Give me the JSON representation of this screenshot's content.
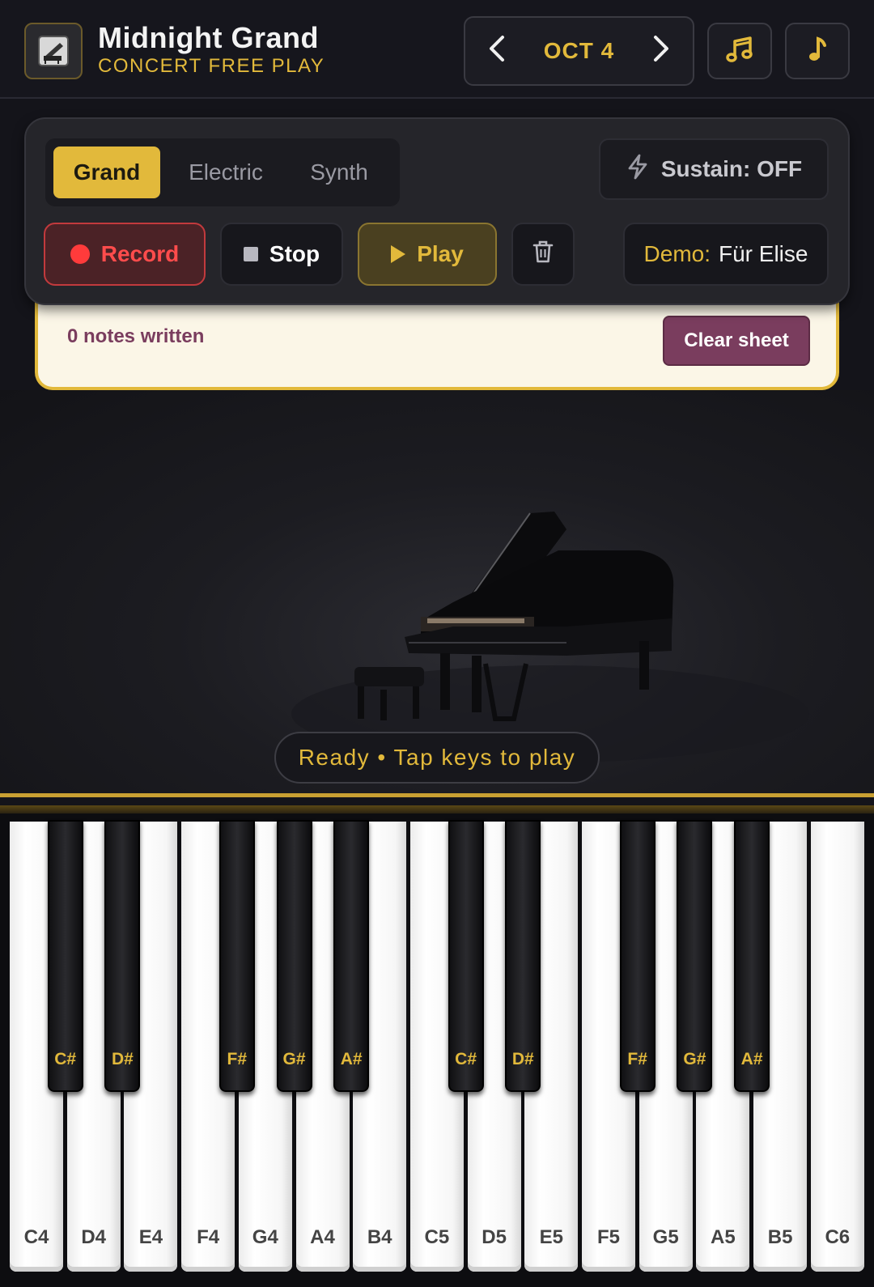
{
  "app": {
    "title": "Midnight Grand",
    "subtitle": "CONCERT FREE PLAY"
  },
  "octave": {
    "label": "OCT 4",
    "prev_icon": "chevron-left-icon",
    "next_icon": "chevron-right-icon"
  },
  "header_icons": [
    "music-notes-icon",
    "music-note-icon"
  ],
  "instruments": {
    "tabs": [
      "Grand",
      "Electric",
      "Synth"
    ],
    "active": "Grand"
  },
  "sustain": {
    "label": "Sustain: OFF",
    "icon": "lightning-icon"
  },
  "controls": {
    "record": "Record",
    "stop": "Stop",
    "play": "Play",
    "delete_icon": "trash-icon"
  },
  "demo": {
    "label": "Demo:",
    "value": "Für Elise"
  },
  "sheet": {
    "notes_written": "0 notes written",
    "clear": "Clear sheet"
  },
  "status": "Ready • Tap keys to play",
  "keys": {
    "white": [
      "C4",
      "D4",
      "E4",
      "F4",
      "G4",
      "A4",
      "B4",
      "C5",
      "D5",
      "E5",
      "F5",
      "G5",
      "A5",
      "B5",
      "C6"
    ],
    "black": [
      "C#",
      "D#",
      "F#",
      "G#",
      "A#",
      "C#",
      "D#",
      "F#",
      "G#",
      "A#"
    ]
  },
  "colors": {
    "accent": "#e2b93b",
    "record": "#ff4c4c",
    "clear_button": "#7a3d5e",
    "background": "#14141a"
  }
}
